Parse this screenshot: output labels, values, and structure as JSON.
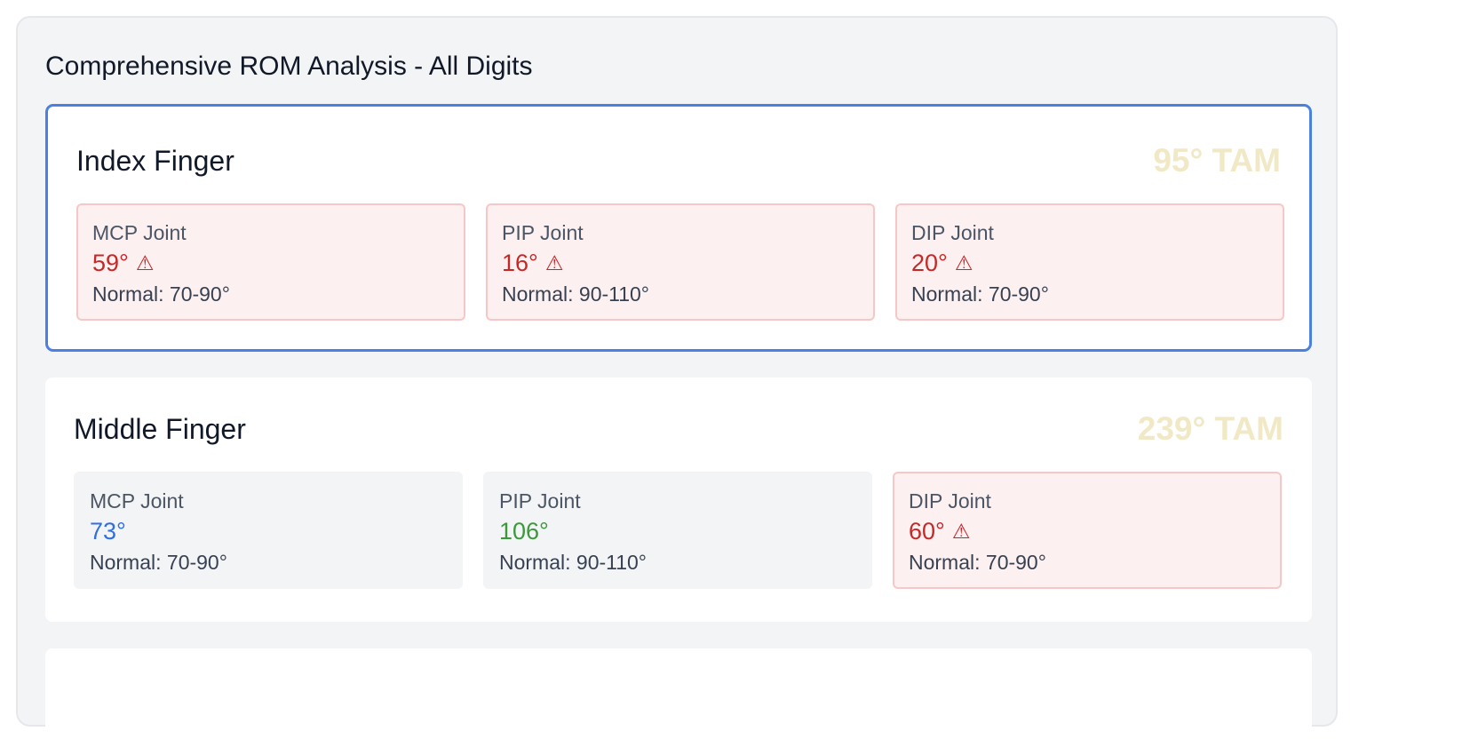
{
  "panel": {
    "title": "Comprehensive ROM Analysis - All Digits"
  },
  "colors": {
    "selected_border": "#4a80e0",
    "tam_text": "#f1e9c6",
    "abnormal_value": "#c62828",
    "low_normal_value": "#2f6fe0",
    "normal_value": "#3a9a3a",
    "abnormal_bg": "#fdf0f0",
    "abnormal_border": "#f6c7c7",
    "normal_bg": "#f3f4f6"
  },
  "fingers": [
    {
      "name": "Index Finger",
      "tam": "95° TAM",
      "selected": true,
      "joints": [
        {
          "name": "MCP Joint",
          "value": "59°",
          "status": "abnormal",
          "warning": "⚠",
          "normal_range": "Normal: 70-90°"
        },
        {
          "name": "PIP Joint",
          "value": "16°",
          "status": "abnormal",
          "warning": "⚠",
          "normal_range": "Normal: 90-110°"
        },
        {
          "name": "DIP Joint",
          "value": "20°",
          "status": "abnormal",
          "warning": "⚠",
          "normal_range": "Normal: 70-90°"
        }
      ]
    },
    {
      "name": "Middle Finger",
      "tam": "239° TAM",
      "selected": false,
      "joints": [
        {
          "name": "MCP Joint",
          "value": "73°",
          "status": "low-normal",
          "warning": "",
          "normal_range": "Normal: 70-90°"
        },
        {
          "name": "PIP Joint",
          "value": "106°",
          "status": "normal",
          "warning": "",
          "normal_range": "Normal: 90-110°"
        },
        {
          "name": "DIP Joint",
          "value": "60°",
          "status": "abnormal",
          "warning": "⚠",
          "normal_range": "Normal: 70-90°"
        }
      ]
    }
  ]
}
